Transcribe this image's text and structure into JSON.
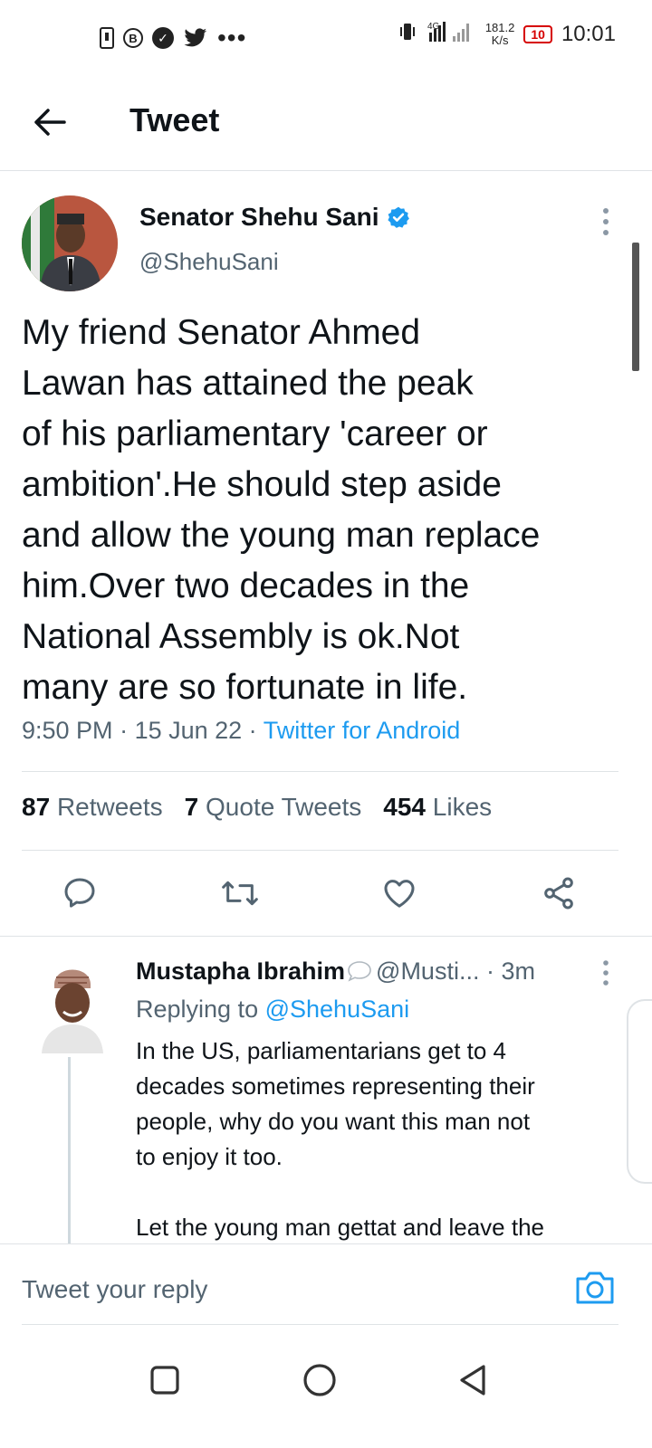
{
  "status_bar": {
    "net_speed": "181.2\nK/s",
    "net_speed_top": "181.2",
    "net_speed_bottom": "K/s",
    "battery": "10",
    "time": "10:01",
    "icons": [
      "sim-icon",
      "b-icon",
      "check-icon",
      "twitter-bird-icon",
      "more-dots-icon",
      "vibrate-icon",
      "signal-icon",
      "battery-icon"
    ]
  },
  "header": {
    "title": "Tweet"
  },
  "tweet": {
    "author_name": "Senator Shehu Sani",
    "handle": "@ShehuSani",
    "text": "My friend Senator Ahmed\nLawan has attained the peak\nof his parliamentary 'career or\nambition'.He should step aside\nand allow the young man replace\nhim.Over two decades in the\nNational Assembly is ok.Not\nmany are so fortunate in life.",
    "time": "9:50 PM",
    "date": "15 Jun 22",
    "source": "Twitter for Android",
    "retweets_count": "87",
    "retweets_label": "Retweets",
    "quotes_count": "7",
    "quotes_label": "Quote Tweets",
    "likes_count": "454",
    "likes_label": "Likes"
  },
  "reply": {
    "name": "Mustapha Ibrahim",
    "handle": "@Musti...",
    "time": "3m",
    "replying_label": "Replying to",
    "replying_to": "@ShehuSani",
    "text": "In the US, parliamentarians get to 4\ndecades sometimes representing their\npeople, why do you want this man not\nto enjoy it too.\n\nLet the young man gettat and leave the"
  },
  "compose": {
    "placeholder": "Tweet your reply"
  },
  "colors": {
    "accent": "#1d9bf0",
    "text": "#0f1419",
    "muted": "#536471",
    "divider": "#dfe3e6"
  }
}
